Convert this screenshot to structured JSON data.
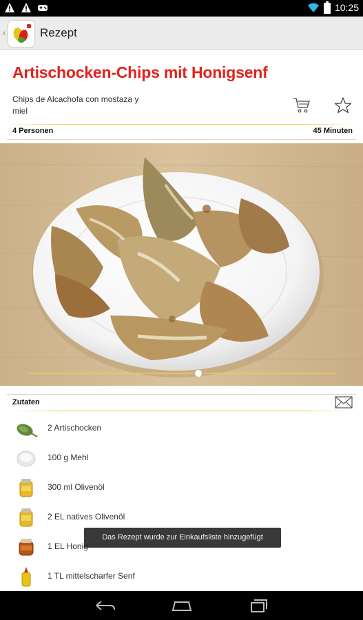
{
  "status_bar": {
    "time": "10:25"
  },
  "action_bar": {
    "title": "Rezept"
  },
  "recipe": {
    "title": "Artischocken-Chips mit Honigsenf",
    "subtitle": "Chips de Alcachofa con mostaza y miel",
    "servings": "4 Personen",
    "duration": "45 Minuten"
  },
  "ingredients": {
    "heading": "Zutaten",
    "items": [
      {
        "text": "2  Artischocken",
        "icon": "artichoke-icon"
      },
      {
        "text": "100 g Mehl",
        "icon": "flour-icon"
      },
      {
        "text": "300 ml Olivenöl",
        "icon": "olive-oil-icon"
      },
      {
        "text": "2 EL natives Olivenöl",
        "icon": "olive-oil-icon"
      },
      {
        "text": "1 EL Honig",
        "icon": "honey-icon"
      },
      {
        "text": "1 TL mittelscharfer Senf",
        "icon": "mustard-icon"
      }
    ]
  },
  "toast": {
    "message": "Das Rezept wurde zur Einkaufsliste hinzugefügt"
  },
  "colors": {
    "title_red": "#e2221b",
    "accent_yellow": "#f0d050",
    "action_bar": "#ececec"
  }
}
